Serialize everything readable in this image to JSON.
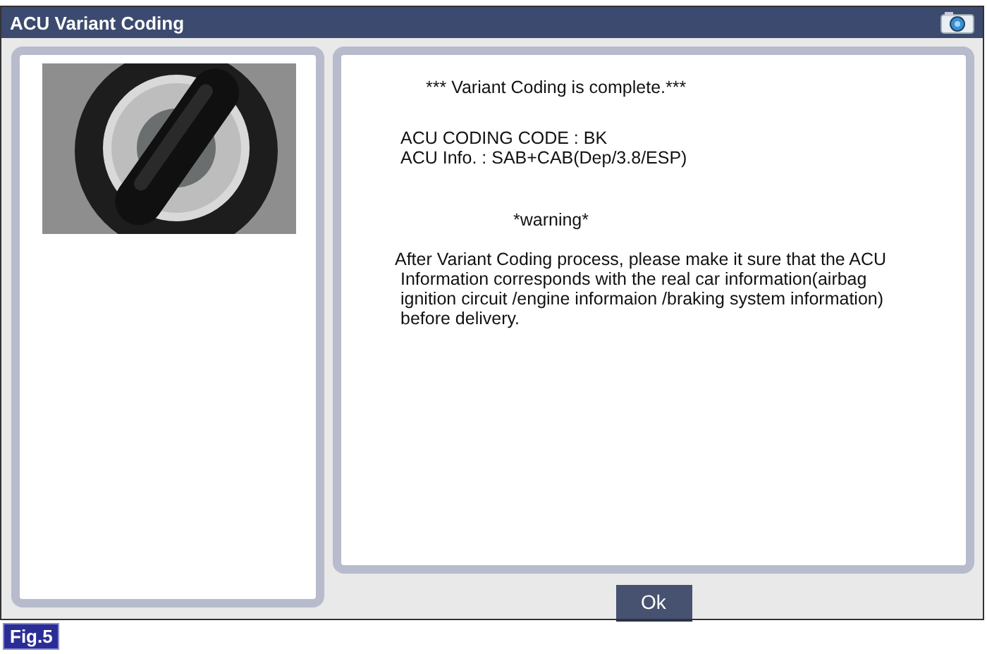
{
  "window": {
    "title": "ACU Variant Coding"
  },
  "left_panel": {
    "image": {
      "kind": "picture"
    }
  },
  "message": {
    "headline": "*** Variant Coding is complete.***",
    "info_lines": [
      "ACU CODING CODE :  BK",
      "ACU Info. : SAB+CAB(Dep/3.8/ESP)"
    ],
    "warning_title": "*warning*",
    "warning_lines": [
      "After Variant Coding process, please make it sure that the ACU",
      "Information corresponds with the real car information(airbag",
      "ignition circuit /engine informaion /braking system information)",
      "before delivery."
    ]
  },
  "buttons": [
    "Ok"
  ],
  "figure_label": "Fig.5"
}
